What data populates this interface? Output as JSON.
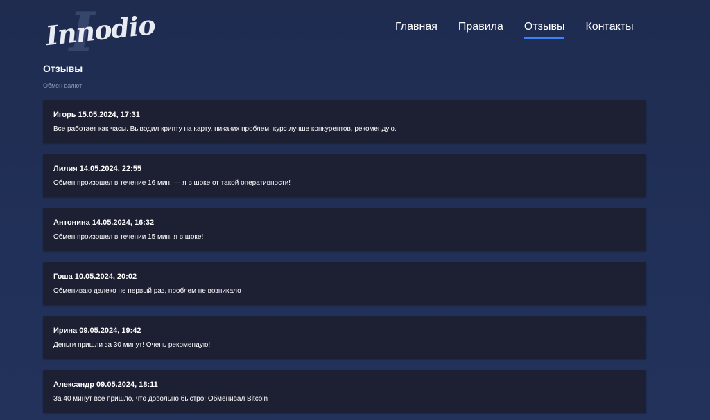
{
  "header": {
    "logo_text": "Innodio",
    "logo_mark": "I",
    "nav": [
      {
        "label": "Главная"
      },
      {
        "label": "Правила"
      },
      {
        "label": "Отзывы"
      },
      {
        "label": "Контакты"
      }
    ],
    "active_nav": "Отзывы",
    "accent_color": "#3b82f6"
  },
  "main": {
    "title": "Отзывы",
    "subtitle": "Обмен валют",
    "reviews": [
      {
        "author": "Игорь",
        "date": "15.05.2024, 17:31",
        "text": "Все работает как часы. Выводил крипту на карту, никаких проблем, курс лучше конкурентов, рекомендую."
      },
      {
        "author": "Лилия",
        "date": "14.05.2024, 22:55",
        "text": "Обмен произошел в течение 16 мин. — я в шоке от такой оперативности!"
      },
      {
        "author": "Антонина",
        "date": "14.05.2024, 16:32",
        "text": "Обмен произошел в течении 15 мин. я в шоке!"
      },
      {
        "author": "Гоша",
        "date": "10.05.2024, 20:02",
        "text": "Обмениваю далеко не первый раз, проблем не возникало"
      },
      {
        "author": "Ирина",
        "date": "09.05.2024, 19:42",
        "text": "Деньги пришли за 30 минут! Очень рекомендую!"
      },
      {
        "author": "Александр",
        "date": "09.05.2024, 18:11",
        "text": "За 40 минут все пришло, что довольно быстро! Обменивал Bitcoin"
      }
    ]
  },
  "colors": {
    "background": "#1f2d52",
    "card": "#1d1f33",
    "muted_text": "#8c97b3"
  }
}
